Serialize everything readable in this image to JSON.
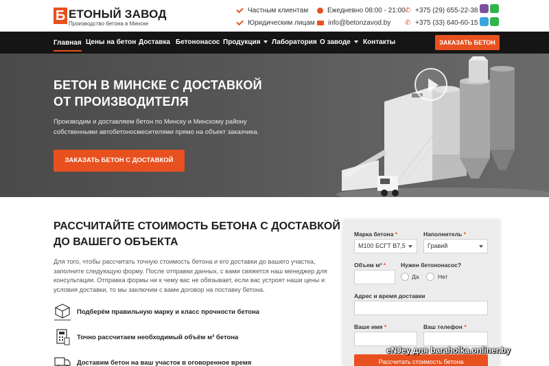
{
  "header": {
    "logo_letter": "Б",
    "logo_title": "ЕТОНЫЙ ЗАВОД",
    "logo_subtitle": "Производство бетона в Минске",
    "clients": [
      "Частным клиентам",
      "Юридическим лицам"
    ],
    "hours": "Ежедневно 08:00 - 21:00",
    "email": "info@betonzavod.by",
    "phones": [
      "+375 (29) 655-22-38",
      "+375 (33) 640-60-15"
    ],
    "messengers": [
      "viber-icon",
      "whatsapp-icon",
      "telegram-icon",
      "whatsapp-icon"
    ]
  },
  "nav": {
    "items": [
      "Главная",
      "Цены на бетон",
      "Доставка",
      "Бетононасос",
      "Продукция",
      "Лаборатория",
      "О заводе",
      "Контакты"
    ],
    "order_button": "ЗАКАЗАТЬ БЕТОН"
  },
  "hero": {
    "title_line1": "БЕТОН В МИНСКЕ С ДОСТАВКОЙ",
    "title_line2": "ОТ ПРОИЗВОДИТЕЛЯ",
    "text": "Производим и доставляем бетон по Минску и Минскому району собственными автобетоносмесителями прямо на объект заказчика.",
    "button": "ЗАКАЗАТЬ БЕТОН С ДОСТАВКОЙ"
  },
  "calc": {
    "title": "РАССЧИТАЙТЕ СТОИМОСТЬ БЕТОНА С ДОСТАВКОЙ ДО ВАШЕГО ОБЪЕКТА",
    "text": "Для того, чтобы рассчитать точную стоимость бетона и его доставки до вашего участка, заполните следующую форму. После отправки данных, с вами свяжется наш менеджер для консультации. Отправка формы ни к чему вас не обязывает, если вас устроят наши цены и условия доставки, то мы заключим с вами договор на поставку бетона.",
    "features": [
      "Подберём правильную марку и класс прочности бетона",
      "Точно рассчитаем необходимый объём м³ бетона",
      "Доставим бетон на ваш участок в оговоренное время"
    ]
  },
  "form": {
    "grade_label": "Марка бетона",
    "grade_value": "М100 БСГТ В7,5",
    "filler_label": "Наполнитель",
    "filler_value": "Гравий",
    "volume_label": "Объем м³",
    "volume_value": "",
    "pump_label": "Нужен бетононасос?",
    "pump_yes": "Да",
    "pump_no": "Нет",
    "address_label": "Адрес и время доставки",
    "name_label": "Ваше имя",
    "phone_label": "Ваш телефон",
    "required_mark": "*",
    "submit": "Рассчитать стоимость бетона"
  },
  "watermark": "eNJey для baraholka.onliner.by",
  "colors": {
    "accent": "#e8511f",
    "nav": "#151515"
  }
}
